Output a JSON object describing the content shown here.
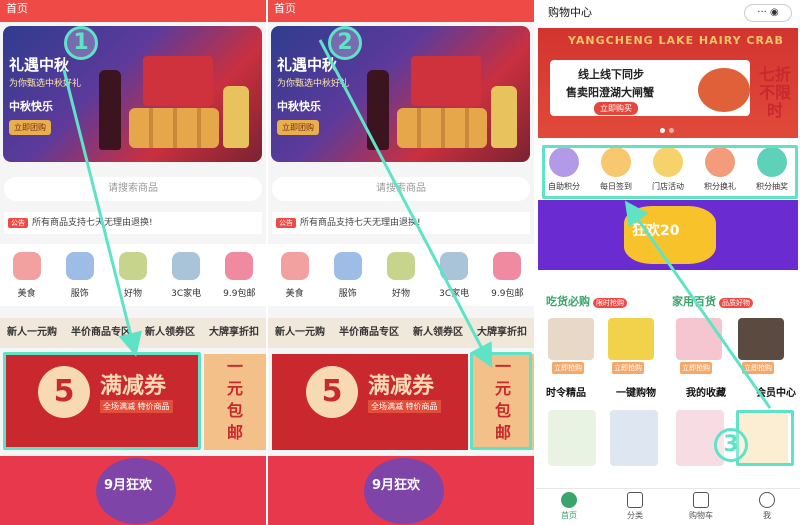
{
  "panels": [
    {
      "topbar_title": "首页",
      "banner": {
        "title": "礼遇中秋",
        "subtitle": "为你甄选中秋好礼",
        "tagline": "中秋快乐",
        "button": "立即团购"
      },
      "search_placeholder": "请搜索商品",
      "notice": {
        "tag": "公告",
        "text": "所有商品支持七天无理由退换!"
      },
      "categories": [
        "美食",
        "服饰",
        "好物",
        "3C家电",
        "9.9包邮"
      ],
      "strip": [
        "新人一元购",
        "半价商品专区",
        "新人领券区",
        "大牌享折扣"
      ],
      "coupon": {
        "number": "5",
        "title": "满减券",
        "sub": "全场满减 特价商品"
      },
      "side_promo": [
        "一",
        "元",
        "包",
        "邮"
      ],
      "bottom_ad": "9月狂欢",
      "step": "1"
    },
    {
      "topbar_title": "首页",
      "banner": {
        "title": "礼遇中秋",
        "subtitle": "为你甄选中秋好礼",
        "tagline": "中秋快乐",
        "button": "立即团购"
      },
      "search_placeholder": "请搜索商品",
      "notice": {
        "tag": "公告",
        "text": "所有商品支持七天无理由退换!"
      },
      "categories": [
        "美食",
        "服饰",
        "好物",
        "3C家电",
        "9.9包邮"
      ],
      "strip": [
        "新人一元购",
        "半价商品专区",
        "新人领券区",
        "大牌享折扣"
      ],
      "coupon": {
        "number": "5",
        "title": "满减券",
        "sub": "全场满减 特价商品"
      },
      "side_promo": [
        "一",
        "元",
        "包",
        "邮"
      ],
      "bottom_ad": "9月狂欢",
      "step": "2"
    }
  ],
  "shop": {
    "title": "购物中心",
    "crab_banner": {
      "header": "YANGCHENG LAKE HAIRY CRAB",
      "line1": "线上线下同步",
      "line2": "售卖阳澄湖大闸蟹",
      "button": "立即购买",
      "corner": "七折 不限时"
    },
    "icons": [
      "自助积分",
      "每日签到",
      "门店活动",
      "积分换礼",
      "积分抽奖"
    ],
    "promo": "狂欢20",
    "sections": [
      {
        "title": "吃货必购",
        "badge": "限时抢购"
      },
      {
        "title": "家用百货",
        "badge": "品质好物"
      }
    ],
    "tags": [
      "立即抢购",
      "立即抢购",
      "立即抢购",
      "立即抢购"
    ],
    "links": [
      "时令精品",
      "一键购物",
      "我的收藏",
      "会员中心"
    ],
    "nav": [
      "首页",
      "分类",
      "购物车",
      "我"
    ],
    "step": "3"
  },
  "colors": {
    "brand_red": "#ef4a45",
    "highlight": "#5fe3c6",
    "active_green": "#3aa56b"
  }
}
